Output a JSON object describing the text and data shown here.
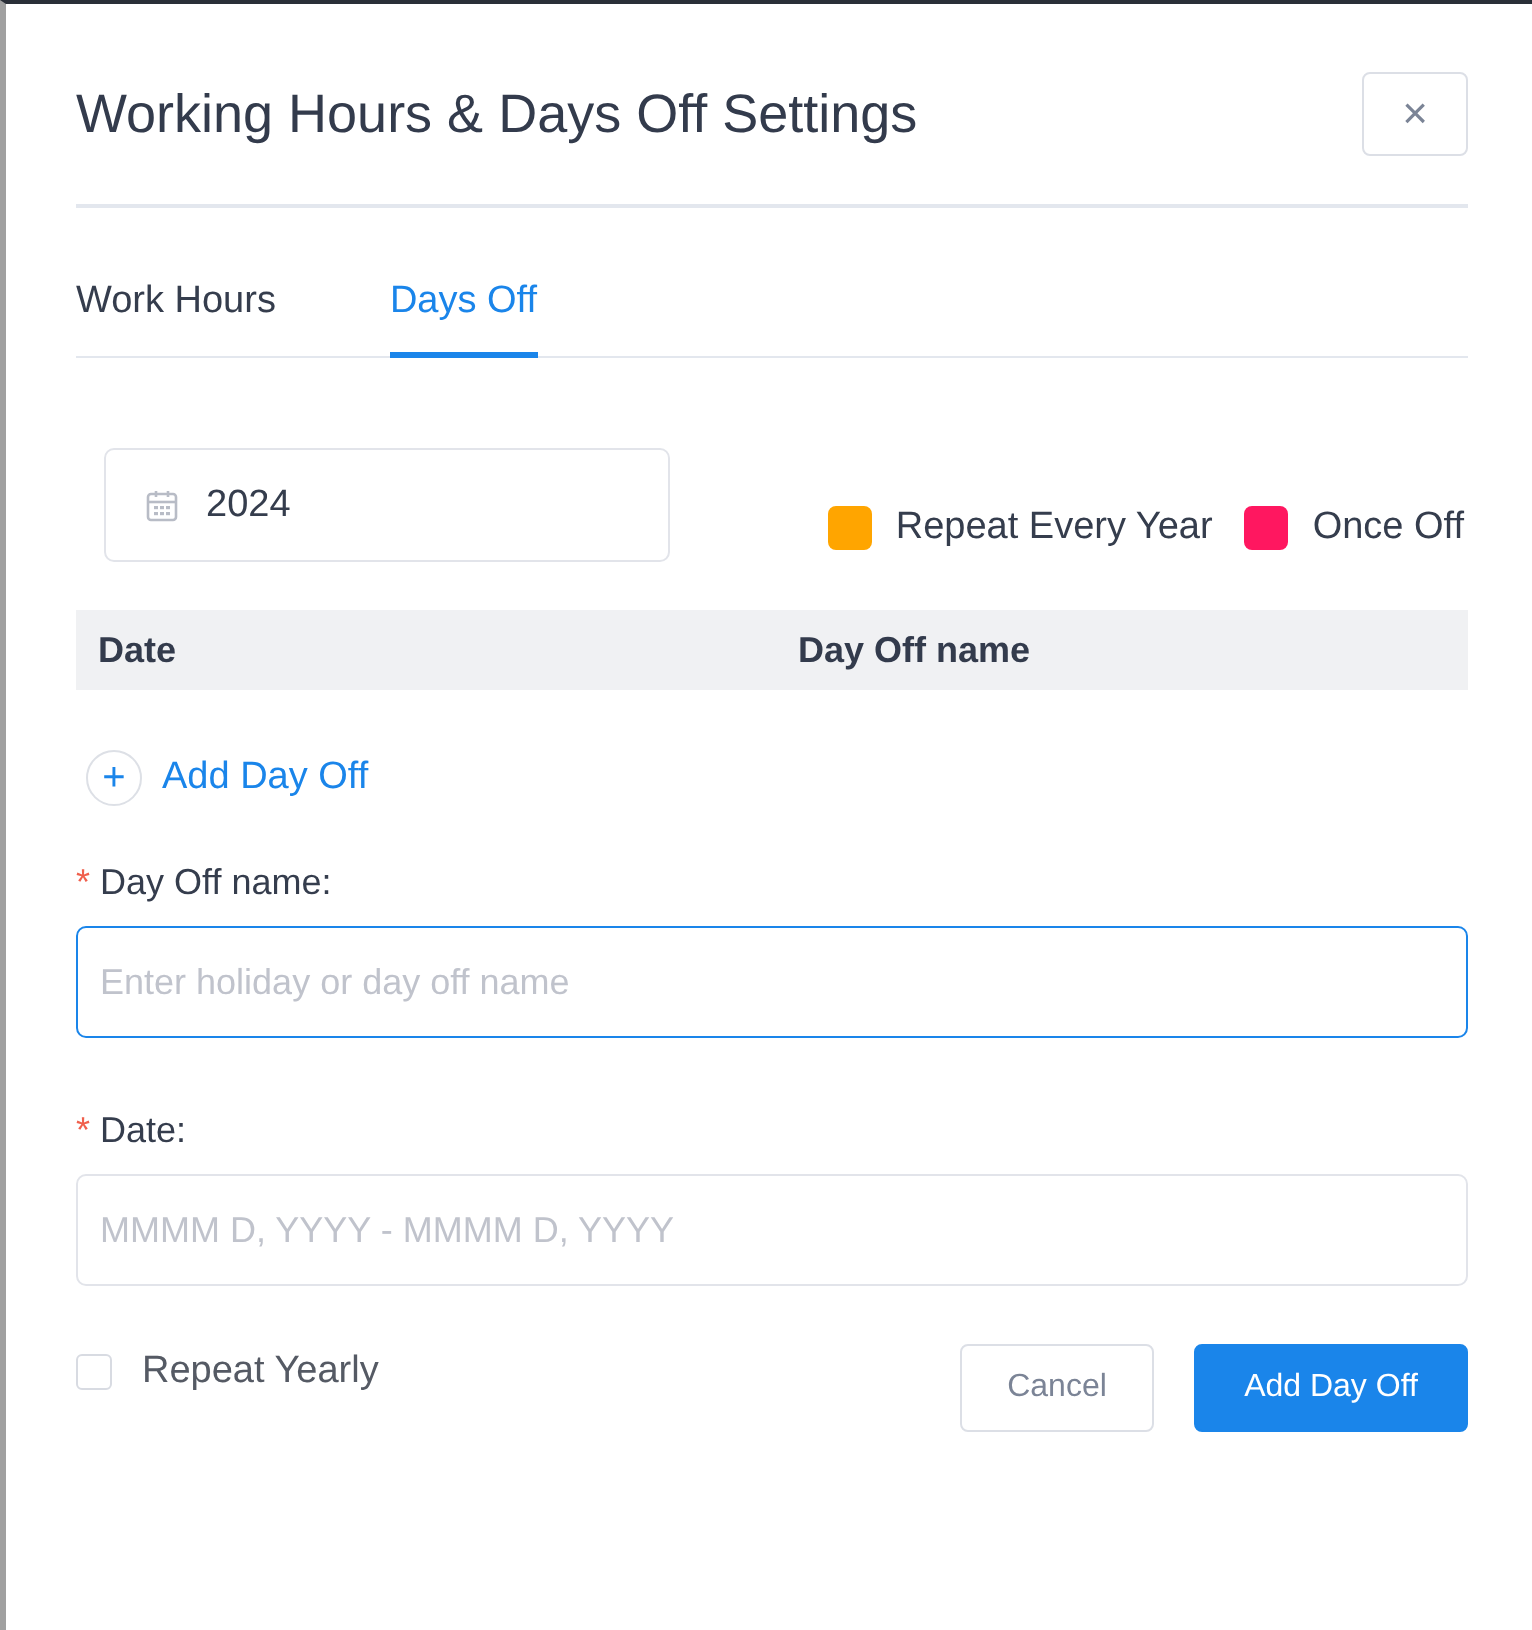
{
  "dialog": {
    "title": "Working Hours & Days Off Settings",
    "close": "×"
  },
  "tabs": [
    {
      "label": "Work Hours",
      "selected": false
    },
    {
      "label": "Days Off",
      "selected": true
    }
  ],
  "year_field": {
    "value": "2024"
  },
  "legend": [
    {
      "label": "Repeat Every Year",
      "color": "#ffa500"
    },
    {
      "label": "Once Off",
      "color": "#ff1760"
    }
  ],
  "table": {
    "columns": [
      "Date",
      "Day Off name"
    ]
  },
  "add_link": {
    "icon": "+",
    "label": "Add Day Off"
  },
  "fields": [
    {
      "label": "Day Off name:",
      "required_mark": "*",
      "placeholder": "Enter holiday or day off name",
      "focused": true
    },
    {
      "label": "Date:",
      "required_mark": "*",
      "placeholder": "MMMM D, YYYY - MMMM D, YYYY",
      "focused": false
    }
  ],
  "repeat_checkbox": {
    "label": "Repeat Yearly",
    "checked": false
  },
  "buttons": [
    {
      "label": "Cancel",
      "kind": "secondary"
    },
    {
      "label": "Add Day Off",
      "kind": "primary"
    }
  ]
}
